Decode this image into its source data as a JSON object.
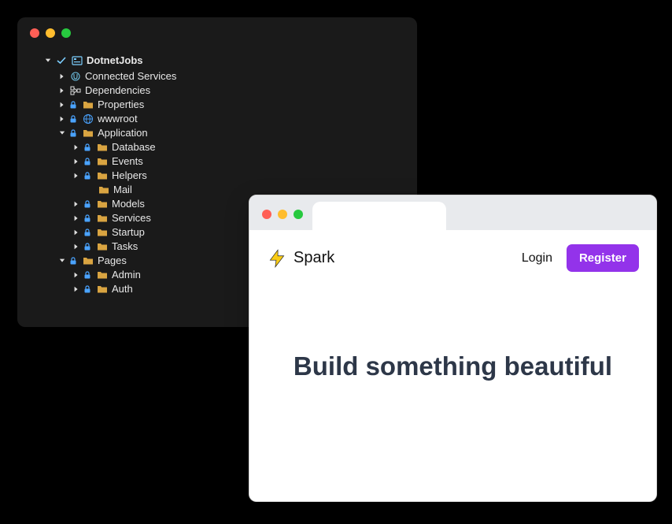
{
  "ide": {
    "root": {
      "label": "DotnetJobs",
      "expanded": true,
      "checked": true
    },
    "items": [
      {
        "level": 1,
        "arrow": "collapsed",
        "lock": false,
        "icon": "plug",
        "label": "Connected Services"
      },
      {
        "level": 1,
        "arrow": "collapsed",
        "lock": false,
        "icon": "dep",
        "label": "Dependencies"
      },
      {
        "level": 1,
        "arrow": "collapsed",
        "lock": true,
        "icon": "folder",
        "label": "Properties"
      },
      {
        "level": 1,
        "arrow": "collapsed",
        "lock": true,
        "icon": "globe",
        "label": "wwwroot"
      },
      {
        "level": 1,
        "arrow": "expanded",
        "lock": true,
        "icon": "folder",
        "label": "Application"
      },
      {
        "level": 2,
        "arrow": "collapsed",
        "lock": true,
        "icon": "folder",
        "label": "Database"
      },
      {
        "level": 2,
        "arrow": "collapsed",
        "lock": true,
        "icon": "folder",
        "label": "Events"
      },
      {
        "level": 2,
        "arrow": "collapsed",
        "lock": true,
        "icon": "folder",
        "label": "Helpers"
      },
      {
        "level": 3,
        "arrow": "none",
        "lock": false,
        "icon": "folder",
        "label": "Mail"
      },
      {
        "level": 2,
        "arrow": "collapsed",
        "lock": true,
        "icon": "folder",
        "label": "Models"
      },
      {
        "level": 2,
        "arrow": "collapsed",
        "lock": true,
        "icon": "folder",
        "label": "Services"
      },
      {
        "level": 2,
        "arrow": "collapsed",
        "lock": true,
        "icon": "folder",
        "label": "Startup"
      },
      {
        "level": 2,
        "arrow": "collapsed",
        "lock": true,
        "icon": "folder",
        "label": "Tasks"
      },
      {
        "level": 1,
        "arrow": "expanded",
        "lock": true,
        "icon": "folder",
        "label": "Pages"
      },
      {
        "level": 2,
        "arrow": "collapsed",
        "lock": true,
        "icon": "folder",
        "label": "Admin"
      },
      {
        "level": 2,
        "arrow": "collapsed",
        "lock": true,
        "icon": "folder",
        "label": "Auth"
      }
    ]
  },
  "browser": {
    "brand": "Spark",
    "login_label": "Login",
    "register_label": "Register",
    "hero_title": "Build something beautiful"
  },
  "colors": {
    "accent": "#9333ea",
    "bolt": "#facc15",
    "folder": "#d9a441",
    "lock": "#4aa3ff",
    "globe": "#4aa3ff"
  }
}
